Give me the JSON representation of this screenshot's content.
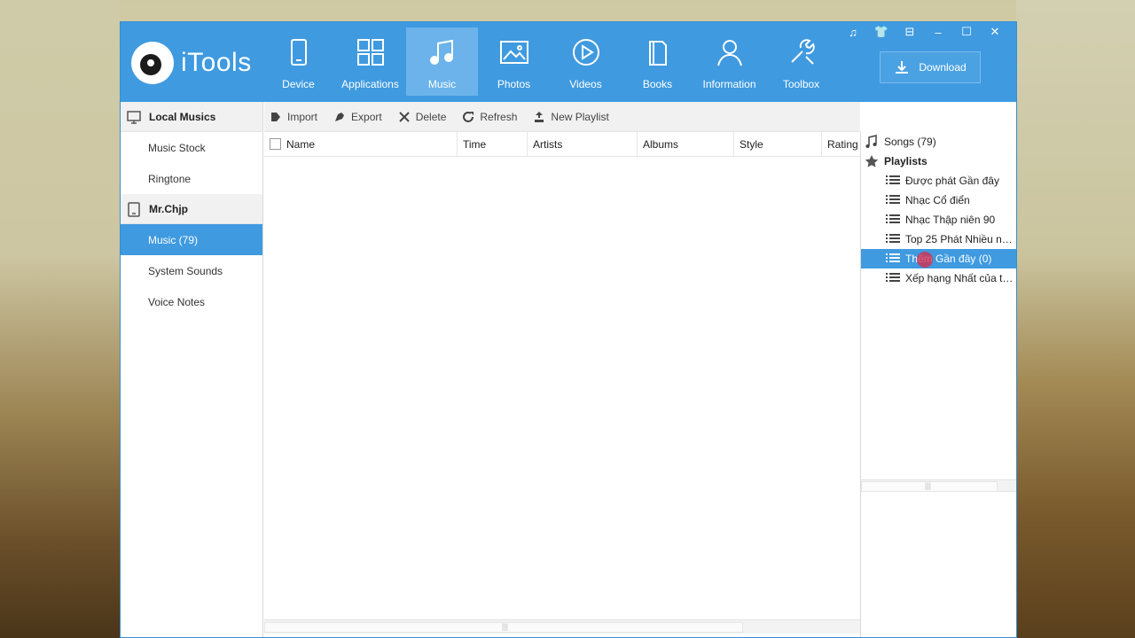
{
  "app": {
    "name": "iTools"
  },
  "window_controls": [
    "♫",
    "👕",
    "⊟",
    "–",
    "☐",
    "✕"
  ],
  "nav": [
    {
      "label": "Device",
      "icon": "device-icon"
    },
    {
      "label": "Applications",
      "icon": "applications-icon"
    },
    {
      "label": "Music",
      "icon": "music-icon",
      "active": true
    },
    {
      "label": "Photos",
      "icon": "photos-icon"
    },
    {
      "label": "Videos",
      "icon": "videos-icon"
    },
    {
      "label": "Books",
      "icon": "books-icon"
    },
    {
      "label": "Information",
      "icon": "information-icon"
    },
    {
      "label": "Toolbox",
      "icon": "toolbox-icon"
    }
  ],
  "download": {
    "label": "Download"
  },
  "sidebar": {
    "local_header": "Local Musics",
    "local_items": [
      "Music Stock",
      "Ringtone"
    ],
    "device_header": "Mr.Chjp",
    "device_items": [
      "Music (79)",
      "System Sounds",
      "Voice Notes"
    ]
  },
  "toolbar": {
    "import": "Import",
    "export": "Export",
    "delete": "Delete",
    "refresh": "Refresh",
    "new_playlist": "New Playlist"
  },
  "table": {
    "columns": [
      "Name",
      "Time",
      "Artists",
      "Albums",
      "Style",
      "Rating"
    ]
  },
  "tree": {
    "songs": "Songs (79)",
    "playlists_header": "Playlists",
    "playlists": [
      "Được phát Gần đây",
      "Nhạc Cổ điển",
      "Nhạc Thập niên 90",
      "Top 25 Phát Nhiều nh...",
      "Thêm Gần đây (0)",
      "Xếp hạng Nhất của tôi..."
    ]
  },
  "colors": {
    "accent": "#3f9ae0",
    "header": "#3f9ae0"
  }
}
